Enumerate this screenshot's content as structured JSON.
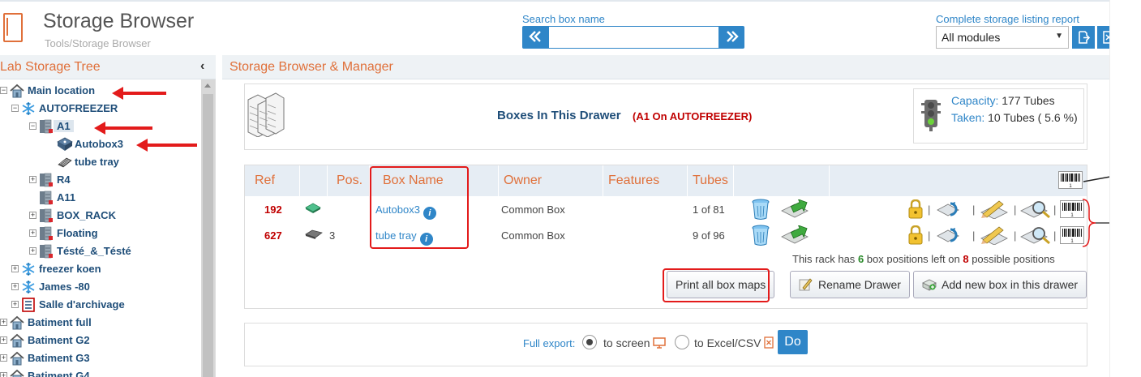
{
  "header": {
    "title": "Storage Browser",
    "breadcrumb": "Tools/Storage Browser",
    "search_label": "Search box name",
    "search_value": "",
    "report_label": "Complete storage listing report",
    "module_selected": "All modules"
  },
  "tree": {
    "title": "Lab Storage Tree",
    "nodes": [
      {
        "label": "Main location",
        "icon": "home-icon",
        "toggle": "-"
      },
      {
        "label": "AUTOFREEZER",
        "icon": "snowflake-icon",
        "toggle": "-"
      },
      {
        "label": "A1",
        "icon": "rack-icon",
        "toggle": "-"
      },
      {
        "label": "Autobox3",
        "icon": "box-icon",
        "toggle": ""
      },
      {
        "label": "tube tray",
        "icon": "tray-icon",
        "toggle": ""
      },
      {
        "label": "R4",
        "icon": "rack-icon",
        "toggle": "+"
      },
      {
        "label": "A11",
        "icon": "rack-icon",
        "toggle": ""
      },
      {
        "label": "BOX_RACK",
        "icon": "rack-icon",
        "toggle": "+"
      },
      {
        "label": "Floating",
        "icon": "rack-icon",
        "toggle": "+"
      },
      {
        "label": "Tésté_&_Tésté",
        "icon": "rack-icon",
        "toggle": "+"
      },
      {
        "label": "freezer koen",
        "icon": "snowflake-icon",
        "toggle": "+"
      },
      {
        "label": "James -80",
        "icon": "snowflake-icon",
        "toggle": "+"
      },
      {
        "label": "Salle d'archivage",
        "icon": "cabinet-icon",
        "toggle": "+"
      },
      {
        "label": "Batiment full",
        "icon": "home-icon",
        "toggle": "+"
      },
      {
        "label": "Batiment G2",
        "icon": "home-icon",
        "toggle": "+"
      },
      {
        "label": "Batiment G3",
        "icon": "home-icon",
        "toggle": "+"
      },
      {
        "label": "Batiment G4",
        "icon": "home-icon",
        "toggle": "+"
      }
    ]
  },
  "main": {
    "title": "Storage Browser & Manager",
    "drawer_title": "Boxes In This Drawer",
    "drawer_sub": "(A1 On AUTOFREEZER)",
    "capacity_label": "Capacity:",
    "capacity_value": "177 Tubes",
    "taken_label": "Taken:",
    "taken_value": "10 Tubes ( 5.6 %)",
    "columns": [
      "Ref",
      "Pos.",
      "Box Name",
      "Owner",
      "Features",
      "Tubes"
    ],
    "rows": [
      {
        "ref": "192",
        "pos": "",
        "name": "Autobox3",
        "owner": "Common Box",
        "tubes": "1 of 81"
      },
      {
        "ref": "627",
        "pos": "3",
        "name": "tube tray",
        "owner": "Common Box",
        "tubes": "9 of 96"
      }
    ],
    "rack_info_pre": "This rack has",
    "rack_left": "6",
    "rack_info_mid": "box positions left on",
    "rack_total": "8",
    "rack_info_post": "possible positions",
    "print_button": "Print all box maps",
    "rename_button": "Rename Drawer",
    "add_button": "Add new box in this drawer",
    "export_label": "Full export:",
    "export_screen": "to screen",
    "export_excel": "to Excel/CSV",
    "do_button": "Do"
  },
  "annotations": {
    "circle1": "1",
    "circle2": "2"
  },
  "colors": {
    "accent_blue": "#2f86c8",
    "header_orange": "#e0703a",
    "ref_red": "#c00000",
    "annotation_red": "#e31b1b"
  }
}
